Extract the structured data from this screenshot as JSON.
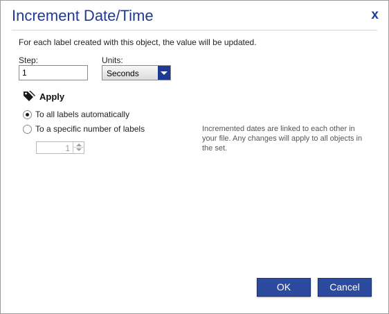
{
  "dialog": {
    "title": "Increment Date/Time",
    "close_label": "x"
  },
  "description": "For each label created with this object, the value will be updated.",
  "step": {
    "label": "Step:",
    "value": "1"
  },
  "units": {
    "label": "Units:",
    "selected": "Seconds"
  },
  "apply": {
    "title": "Apply",
    "icon": "tags-icon",
    "options": [
      {
        "label": "To all labels automatically",
        "selected": true
      },
      {
        "label": "To a specific number of labels",
        "selected": false
      }
    ],
    "count_value": "1"
  },
  "note": "Incremented dates are linked to each other in your file. Any changes will apply to all objects in the set.",
  "buttons": {
    "ok": "OK",
    "cancel": "Cancel"
  },
  "colors": {
    "accent": "#1f3a93",
    "button": "#2c4a9e"
  }
}
